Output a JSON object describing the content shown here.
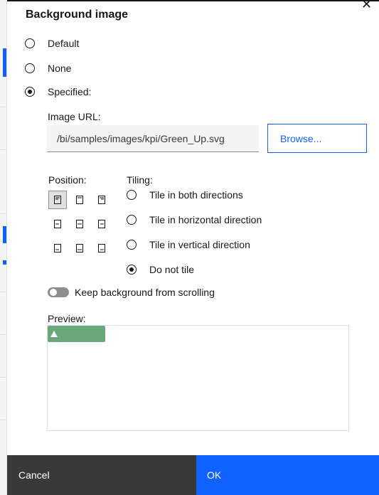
{
  "dialog": {
    "title": "Background image",
    "close_icon": "close-icon"
  },
  "source_options": [
    {
      "label": "Default",
      "checked": false
    },
    {
      "label": "None",
      "checked": false
    },
    {
      "label": "Specified:",
      "checked": true
    }
  ],
  "image_url": {
    "label": "Image URL:",
    "value": "/bi/samples/images/kpi/Green_Up.svg"
  },
  "browse_label": "Browse...",
  "position": {
    "label": "Position:",
    "selected": "top-left",
    "cells": [
      "top-left",
      "top-center",
      "top-right",
      "middle-left",
      "middle-center",
      "middle-right",
      "bottom-left",
      "bottom-center",
      "bottom-right"
    ]
  },
  "tiling": {
    "label": "Tiling:",
    "options": [
      {
        "label": "Tile in both directions",
        "checked": false
      },
      {
        "label": "Tile in horizontal direction",
        "checked": false
      },
      {
        "label": "Tile in vertical direction",
        "checked": false
      },
      {
        "label": "Do not tile",
        "checked": true
      }
    ]
  },
  "keep_background": {
    "label": "Keep background from scrolling",
    "on": false
  },
  "preview": {
    "label": "Preview:",
    "image_color": "#6aa77a"
  },
  "footer": {
    "cancel_label": "Cancel",
    "ok_label": "OK"
  },
  "colors": {
    "primary": "#0f62fe",
    "secondary_button": "#393939"
  }
}
